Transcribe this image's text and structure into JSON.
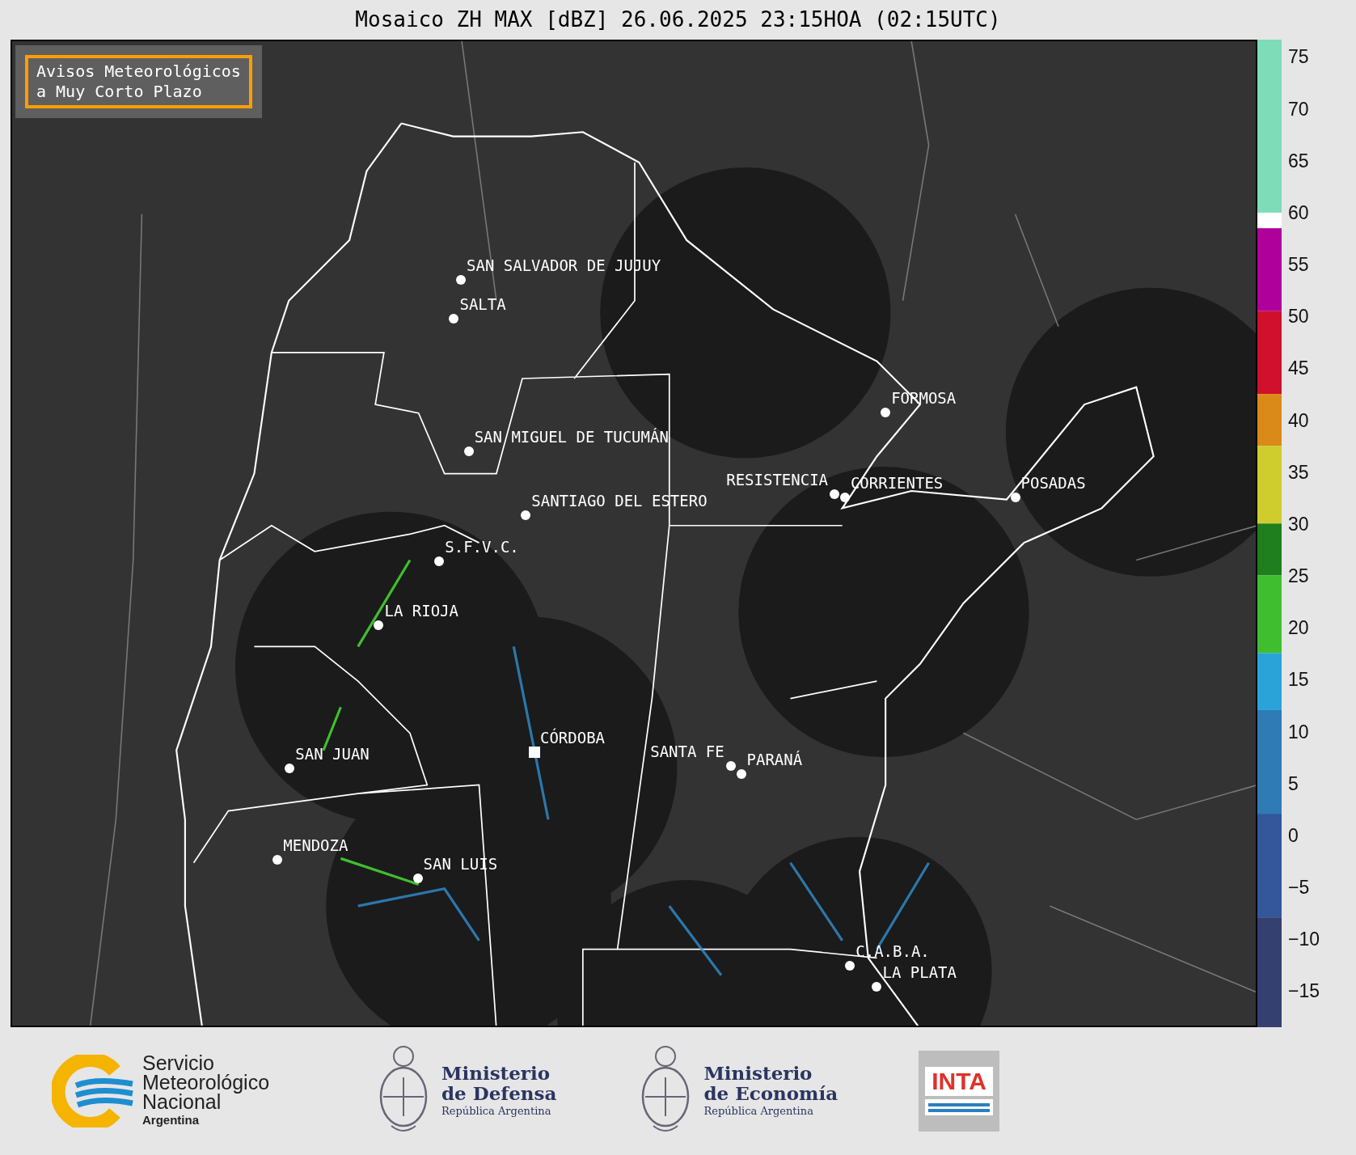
{
  "title": "Mosaico ZH MAX [dBZ] 26.06.2025 23:15HOA (02:15UTC)",
  "notice": "Avisos Meteorológicos\na Muy Corto Plazo",
  "cities": [
    {
      "name": "SAN SALVADOR DE JUJUY",
      "kind": "dot"
    },
    {
      "name": "SALTA",
      "kind": "dot"
    },
    {
      "name": "FORMOSA",
      "kind": "dot"
    },
    {
      "name": "SAN MIGUEL DE TUCUMÁN",
      "kind": "dot"
    },
    {
      "name": "RESISTENCIA",
      "kind": "dot"
    },
    {
      "name": "CORRIENTES",
      "kind": "dot"
    },
    {
      "name": "POSADAS",
      "kind": "dot"
    },
    {
      "name": "SANTIAGO DEL ESTERO",
      "kind": "dot"
    },
    {
      "name": "S.F.V.C.",
      "kind": "dot"
    },
    {
      "name": "LA RIOJA",
      "kind": "dot"
    },
    {
      "name": "SAN JUAN",
      "kind": "dot"
    },
    {
      "name": "CÓRDOBA",
      "kind": "square"
    },
    {
      "name": "SANTA FE",
      "kind": "dot"
    },
    {
      "name": "PARANÁ",
      "kind": "dot"
    },
    {
      "name": "MENDOZA",
      "kind": "dot"
    },
    {
      "name": "SAN LUIS",
      "kind": "dot"
    },
    {
      "name": "C.A.B.A.",
      "kind": "dot"
    },
    {
      "name": "LA PLATA",
      "kind": "dot"
    }
  ],
  "colorbar": {
    "ticks": [
      "75",
      "70",
      "65",
      "60",
      "55",
      "50",
      "45",
      "40",
      "35",
      "30",
      "25",
      "20",
      "15",
      "10",
      "5",
      "0",
      "−5",
      "−10",
      "−15"
    ]
  },
  "footer": [
    {
      "kind": "smn",
      "lines": [
        "Servicio",
        "Meteorológico",
        "Nacional"
      ],
      "sub": "Argentina"
    },
    {
      "kind": "ministry",
      "lines": [
        "Ministerio",
        "de Defensa"
      ],
      "sub": "República Argentina"
    },
    {
      "kind": "ministry",
      "lines": [
        "Ministerio",
        "de Economía"
      ],
      "sub": "República Argentina"
    },
    {
      "kind": "inta",
      "lines": [
        "INTA"
      ]
    }
  ]
}
